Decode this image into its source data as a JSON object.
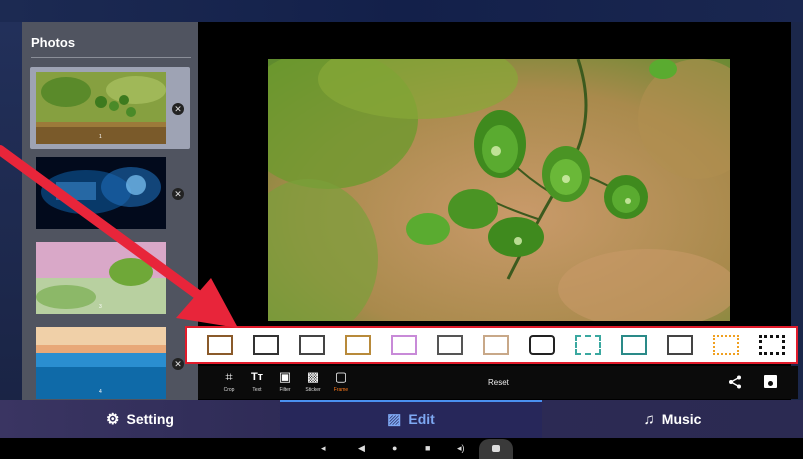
{
  "sidebar": {
    "title": "Photos",
    "items": [
      {
        "name": "green-leaves-photo",
        "selected": true,
        "number": "1"
      },
      {
        "name": "blue-particles-photo",
        "selected": false,
        "number": ""
      },
      {
        "name": "pink-flowers-photo",
        "selected": false,
        "number": "3"
      },
      {
        "name": "ocean-sunset-photo",
        "selected": false,
        "number": "4"
      }
    ]
  },
  "toolbar": {
    "tools": [
      {
        "label": "Crop",
        "icon": "crop-icon"
      },
      {
        "label": "Text",
        "icon": "text-icon"
      },
      {
        "label": "Filter",
        "icon": "filter-icon"
      },
      {
        "label": "Sticker",
        "icon": "sticker-icon"
      },
      {
        "label": "Frame",
        "icon": "frame-icon",
        "active": true
      }
    ],
    "reset_label": "Reset"
  },
  "tabs": {
    "setting": "Setting",
    "edit": "Edit",
    "music": "Music"
  },
  "colors": {
    "accent": "#4a90f0",
    "active_tool": "#ff7a1a",
    "highlight_border": "#e21b2b"
  }
}
